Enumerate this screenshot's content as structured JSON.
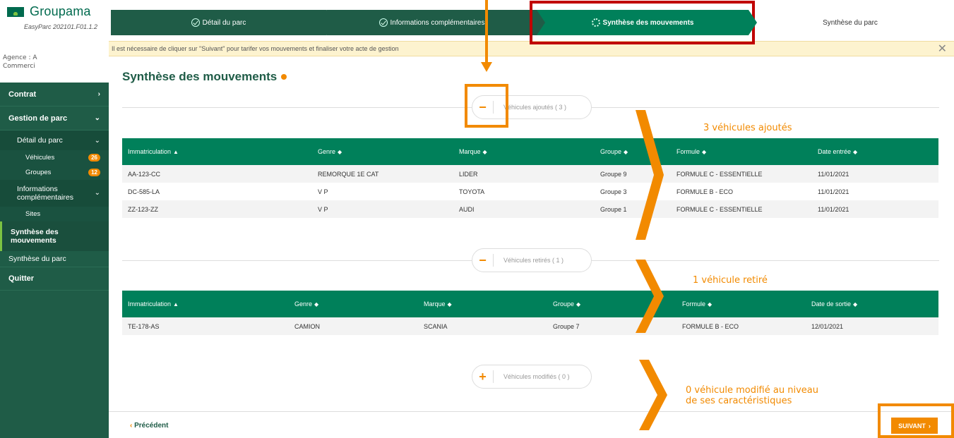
{
  "brand": {
    "name": "Groupama",
    "version": "EasyParc 202101.F01.1.2"
  },
  "agency": {
    "line1": "Agence : A",
    "line2": "Commerci"
  },
  "nav": {
    "contrat": "Contrat",
    "gestion": "Gestion de parc",
    "detail": "Détail du parc",
    "vehicules": "Véhicules",
    "vehicules_count": "26",
    "groupes": "Groupes",
    "groupes_count": "12",
    "infos": "Informations complémentaires",
    "sites": "Sites",
    "synthese_mouv": "Synthèse des mouvements",
    "synthese_parc": "Synthèse du parc",
    "quitter": "Quitter"
  },
  "stepper": {
    "step1": "Détail du parc",
    "step2": "Informations complémentaires",
    "step3": "Synthèse des mouvements",
    "step4": "Synthèse du parc"
  },
  "banner": "Il est nécessaire de cliquer sur \"Suivant\" pour tarifer vos mouvements et finaliser votre acte de gestion",
  "page_title": "Synthèse des mouvements",
  "added": {
    "toggle": "−",
    "label": "Véhicules ajoutés ( 3 )",
    "headers": [
      "Immatriculation",
      "Genre",
      "Marque",
      "Groupe",
      "Formule",
      "Date entrée"
    ],
    "header_sort": [
      "▲",
      "◆",
      "◆",
      "◆",
      "◆",
      "◆"
    ],
    "rows": [
      [
        "AA-123-CC",
        "REMORQUE 1E CAT",
        "LIDER",
        "Groupe 9",
        "FORMULE C - ESSENTIELLE",
        "11/01/2021"
      ],
      [
        "DC-585-LA",
        "V P",
        "TOYOTA",
        "Groupe 3",
        "FORMULE B - ECO",
        "11/01/2021"
      ],
      [
        "ZZ-123-ZZ",
        "V P",
        "AUDI",
        "Groupe 1",
        "FORMULE C - ESSENTIELLE",
        "11/01/2021"
      ]
    ]
  },
  "removed": {
    "toggle": "−",
    "label": "Véhicules retirés ( 1 )",
    "headers": [
      "Immatriculation",
      "Genre",
      "Marque",
      "Groupe",
      "Formule",
      "Date de sortie"
    ],
    "header_sort": [
      "▲",
      "◆",
      "◆",
      "◆",
      "◆",
      "◆"
    ],
    "rows": [
      [
        "TE-178-AS",
        "CAMION",
        "SCANIA",
        "Groupe 7",
        "FORMULE B - ECO",
        "12/01/2021"
      ]
    ]
  },
  "modified": {
    "toggle": "+",
    "label": "Véhicules modifiés ( 0 )"
  },
  "footer": {
    "prev": "Précédent",
    "next": "SUIVANT"
  },
  "annotations": {
    "added": "3 véhicules ajoutés",
    "removed": "1 véhicule retiré",
    "modified_line1": "0 véhicule modifié au niveau",
    "modified_line2": "de ses caractéristiques"
  },
  "colors": {
    "primary": "#1f5c47",
    "accent": "#00805a",
    "orange": "#f28a00",
    "banner": "#fdf3cf"
  }
}
